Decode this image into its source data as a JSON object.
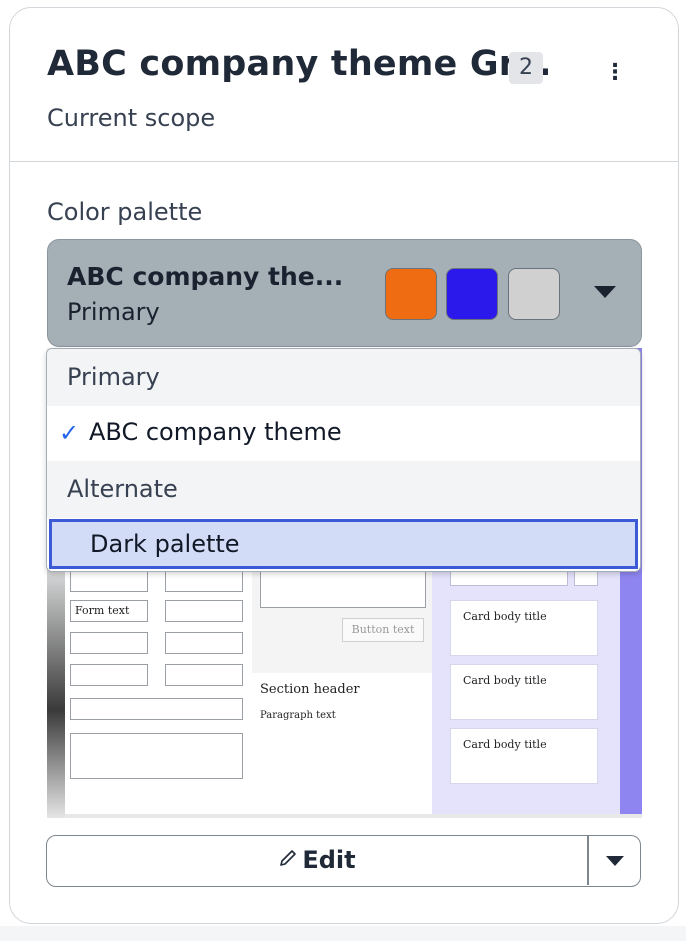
{
  "header": {
    "title": "ABC company theme Gr...",
    "count": "2",
    "menu_icon": "kebab-menu-icon",
    "subtitle": "Current scope"
  },
  "palette": {
    "label": "Color palette",
    "selected_name": "ABC company the...",
    "selected_group": "Primary",
    "swatches": [
      "#f06c12",
      "#2a19ea",
      "#d0d0d0"
    ],
    "dropdown_icon": "caret-down-icon"
  },
  "dropdown": {
    "groups": [
      {
        "label": "Primary",
        "options": [
          {
            "label": "ABC company theme",
            "checked": true
          }
        ]
      },
      {
        "label": "Alternate",
        "options": [
          {
            "label": "Dark palette",
            "highlighted": true
          }
        ]
      }
    ],
    "check_icon": "✓"
  },
  "preview": {
    "form_text": "Form text",
    "button_text": "Button text",
    "section_header": "Section header",
    "paragraph_text": "Paragraph text",
    "card_titles": [
      "Card body title",
      "Card body title",
      "Card body title"
    ]
  },
  "actions": {
    "edit_label": "Edit",
    "edit_icon": "pencil-icon",
    "more_icon": "caret-down-icon"
  },
  "colors": {
    "select_bg": "#a5afb6",
    "highlight_bg": "#d3dcf6",
    "highlight_border": "#3c59d6",
    "check": "#2563eb"
  }
}
